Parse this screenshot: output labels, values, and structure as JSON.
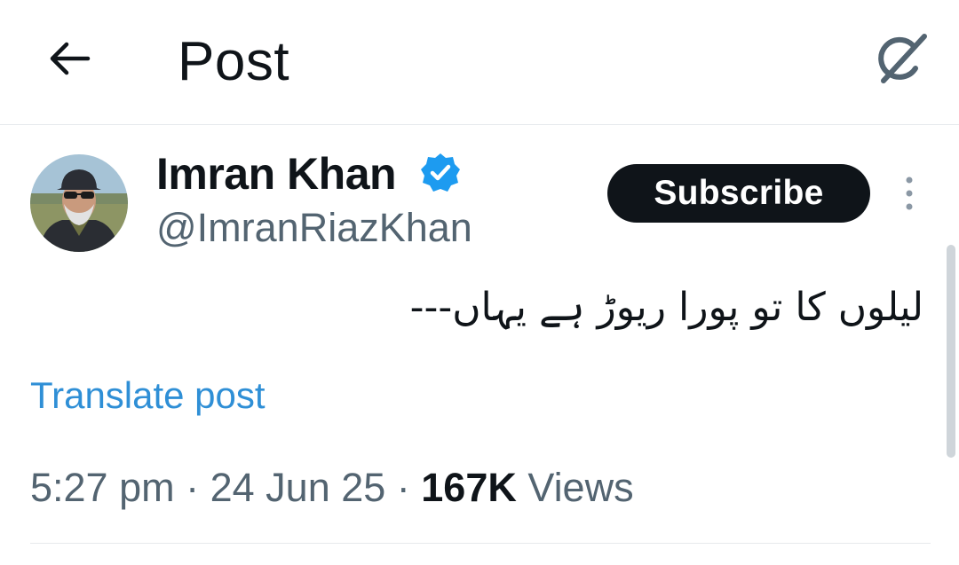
{
  "header": {
    "title": "Post",
    "back_icon": "arrow-left-icon",
    "grok_icon": "grok-icon"
  },
  "post": {
    "author_name": "Imran Khan",
    "verified": true,
    "verified_color": "#1d9bf0",
    "handle": "@ImranRiazKhan",
    "subscribe_label": "Subscribe",
    "text": "لیلوں کا تو پورا ریوڑ ہے یہاں---",
    "translate_label": "Translate post",
    "time": "5:27 pm",
    "separator": " · ",
    "date": "24 Jun 25",
    "views_count": "167K",
    "views_label": " Views"
  },
  "colors": {
    "link": "#2f8fd6",
    "muted": "#536471",
    "text": "#0f1419"
  }
}
